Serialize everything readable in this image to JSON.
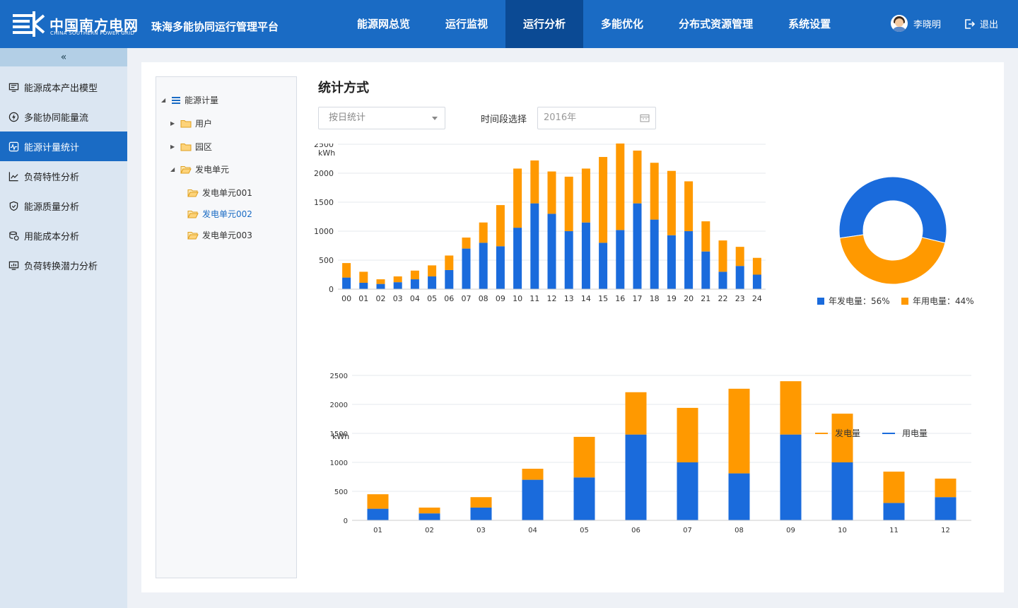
{
  "header": {
    "logo_cn": "中国南方电网",
    "logo_en": "CHINA SOUTHERN POWER GRID",
    "platform": "珠海多能协同运行管理平台",
    "nav": [
      {
        "label": "能源网总览",
        "active": false
      },
      {
        "label": "运行监视",
        "active": false
      },
      {
        "label": "运行分析",
        "active": true
      },
      {
        "label": "多能优化",
        "active": false
      },
      {
        "label": "分布式资源管理",
        "active": false
      },
      {
        "label": "系统设置",
        "active": false
      }
    ],
    "user_name": "李晓明",
    "logout_label": "退出"
  },
  "sidebar": {
    "collapse_label": "«",
    "items": [
      {
        "label": "能源成本产出模型",
        "icon": "monitor-icon",
        "active": false
      },
      {
        "label": "多能协同能量流",
        "icon": "energy-flow-icon",
        "active": false
      },
      {
        "label": "能源计量统计",
        "icon": "meter-stats-icon",
        "active": true
      },
      {
        "label": "负荷特性分析",
        "icon": "line-chart-icon",
        "active": false
      },
      {
        "label": "能源质量分析",
        "icon": "shield-check-icon",
        "active": false
      },
      {
        "label": "用能成本分析",
        "icon": "coin-stack-icon",
        "active": false
      },
      {
        "label": "负荷转换潜力分析",
        "icon": "screen-chart-icon",
        "active": false
      }
    ]
  },
  "tree": {
    "root": "能源计量",
    "user": "用户",
    "park": "园区",
    "gen": "发电单元",
    "gen_children": [
      "发电单元001",
      "发电单元002",
      "发电单元003"
    ],
    "selected_index": 1
  },
  "filters": {
    "heading": "统计方式",
    "mode_value": "按日统计",
    "period_label": "时间段选择",
    "date_placeholder": "2016年"
  },
  "colors": {
    "generation": "#1a6bdc",
    "consumption": "#ff9900",
    "brand": "#1a6bc4"
  },
  "chart_data": [
    {
      "type": "bar",
      "stacked": true,
      "ylabel": "kWh",
      "ylim": [
        0,
        2500
      ],
      "yticks": [
        0,
        500,
        1000,
        1500,
        2000,
        2500
      ],
      "grid": true,
      "categories": [
        "00",
        "01",
        "02",
        "03",
        "04",
        "05",
        "06",
        "07",
        "08",
        "09",
        "10",
        "11",
        "12",
        "13",
        "14",
        "15",
        "16",
        "17",
        "18",
        "19",
        "20",
        "21",
        "22",
        "23",
        "24"
      ],
      "series": [
        {
          "color": "#1a6bdc",
          "values": [
            200,
            110,
            90,
            120,
            170,
            220,
            330,
            700,
            800,
            740,
            1060,
            1480,
            1300,
            1000,
            1150,
            800,
            1020,
            1480,
            1200,
            930,
            1000,
            650,
            300,
            400,
            250
          ]
        },
        {
          "color": "#ff9900",
          "values": [
            250,
            190,
            80,
            100,
            150,
            190,
            250,
            190,
            350,
            710,
            1020,
            740,
            730,
            940,
            930,
            1480,
            1540,
            910,
            980,
            1110,
            860,
            520,
            540,
            330,
            290
          ]
        }
      ]
    },
    {
      "type": "pie",
      "donut": true,
      "slices": [
        {
          "name": "年发电量",
          "value": 56,
          "label": "年发电量：56%",
          "color": "#1a6bdc"
        },
        {
          "name": "年用电量",
          "value": 44,
          "label": "年用电量：44%",
          "color": "#ff9900"
        }
      ],
      "legend": "bottom"
    },
    {
      "type": "bar",
      "stacked": true,
      "ylabel": "kWh",
      "ylim": [
        0,
        2500
      ],
      "yticks": [
        0,
        500,
        1000,
        1500,
        2000,
        2500
      ],
      "grid": true,
      "legend": "top-right",
      "categories": [
        "01",
        "02",
        "03",
        "04",
        "05",
        "06",
        "07",
        "08",
        "09",
        "10",
        "11",
        "12"
      ],
      "series": [
        {
          "name": "用电量",
          "color": "#1a6bdc",
          "values": [
            200,
            120,
            220,
            700,
            740,
            1480,
            1000,
            810,
            1480,
            1000,
            300,
            400
          ]
        },
        {
          "name": "发电量",
          "color": "#ff9900",
          "values": [
            250,
            100,
            180,
            190,
            700,
            730,
            940,
            1460,
            920,
            840,
            540,
            320
          ]
        }
      ]
    }
  ]
}
